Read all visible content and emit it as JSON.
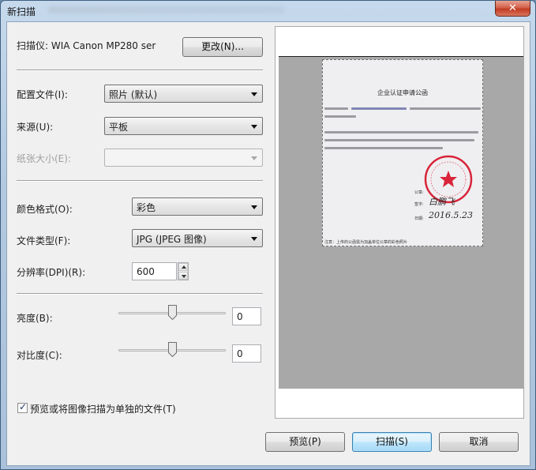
{
  "window": {
    "title": "新扫描",
    "close_glyph": "✕"
  },
  "scanner": {
    "label": "扫描仪: WIA Canon MP280 ser",
    "change_button": "更改(N)..."
  },
  "form": {
    "profile": {
      "label": "配置文件(I):",
      "value": "照片 (默认)"
    },
    "source": {
      "label": "来源(U):",
      "value": "平板"
    },
    "paper_size": {
      "label": "纸张大小(E):",
      "value": "",
      "disabled": true
    },
    "color_format": {
      "label": "颜色格式(O):",
      "value": "彩色"
    },
    "file_type": {
      "label": "文件类型(F):",
      "value": "JPG (JPEG 图像)"
    },
    "resolution": {
      "label": "分辨率(DPI)(R):",
      "value": "600"
    },
    "brightness": {
      "label": "亮度(B):",
      "value": "0",
      "level": 0.5
    },
    "contrast": {
      "label": "对比度(C):",
      "value": "0",
      "level": 0.5
    },
    "separate_files": {
      "label": "预览或将图像扫描为单独的文件(T)",
      "checked": true
    }
  },
  "buttons": {
    "preview": "预览(P)",
    "scan": "扫描(S)",
    "cancel": "取消"
  },
  "preview_doc": {
    "title": "企业认证申请公函",
    "seal_text": "有限公司",
    "label_seal": "公章:",
    "label_sign": "签字:",
    "label_date": "日期:",
    "signature": "白鹏飞",
    "date": "2016.5.23",
    "footnote": "注意：上传的公函需为加盖单位公章的彩色照片"
  },
  "icons": {
    "checkbox": "check-icon",
    "spin": "spin-arrows-icon",
    "dropdown": "chevron-down-icon"
  }
}
